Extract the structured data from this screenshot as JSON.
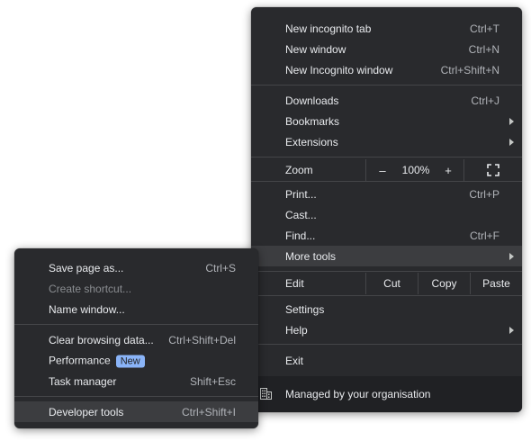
{
  "main_menu": {
    "group1": [
      {
        "label": "New incognito tab",
        "shortcut": "Ctrl+T"
      },
      {
        "label": "New window",
        "shortcut": "Ctrl+N"
      },
      {
        "label": "New Incognito window",
        "shortcut": "Ctrl+Shift+N"
      }
    ],
    "group2": [
      {
        "label": "Downloads",
        "shortcut": "Ctrl+J"
      },
      {
        "label": "Bookmarks"
      },
      {
        "label": "Extensions"
      }
    ],
    "zoom": {
      "label": "Zoom",
      "minus": "–",
      "value": "100%",
      "plus": "+",
      "fullscreen_icon": "fullscreen-icon"
    },
    "group3": [
      {
        "label": "Print...",
        "shortcut": "Ctrl+P"
      },
      {
        "label": "Cast..."
      },
      {
        "label": "Find...",
        "shortcut": "Ctrl+F"
      },
      {
        "label": "More tools"
      }
    ],
    "edit": {
      "label": "Edit",
      "cut": "Cut",
      "copy": "Copy",
      "paste": "Paste"
    },
    "group4": [
      {
        "label": "Settings"
      },
      {
        "label": "Help"
      }
    ],
    "exit": "Exit",
    "managed": {
      "label": "Managed by your organisation",
      "icon": "building-icon"
    }
  },
  "more_tools_submenu": {
    "items1": [
      {
        "label": "Save page as...",
        "shortcut": "Ctrl+S"
      },
      {
        "label": "Create shortcut...",
        "disabled": true
      },
      {
        "label": "Name window..."
      }
    ],
    "items2": [
      {
        "label": "Clear browsing data...",
        "shortcut": "Ctrl+Shift+Del"
      },
      {
        "label": "Performance",
        "badge": "New"
      },
      {
        "label": "Task manager",
        "shortcut": "Shift+Esc"
      }
    ],
    "items3": [
      {
        "label": "Developer tools",
        "shortcut": "Ctrl+Shift+I"
      }
    ]
  },
  "colors": {
    "menu_bg": "#292a2d",
    "hover": "#3c3d40",
    "separator": "#444548",
    "badge": "#8ab4f8"
  }
}
